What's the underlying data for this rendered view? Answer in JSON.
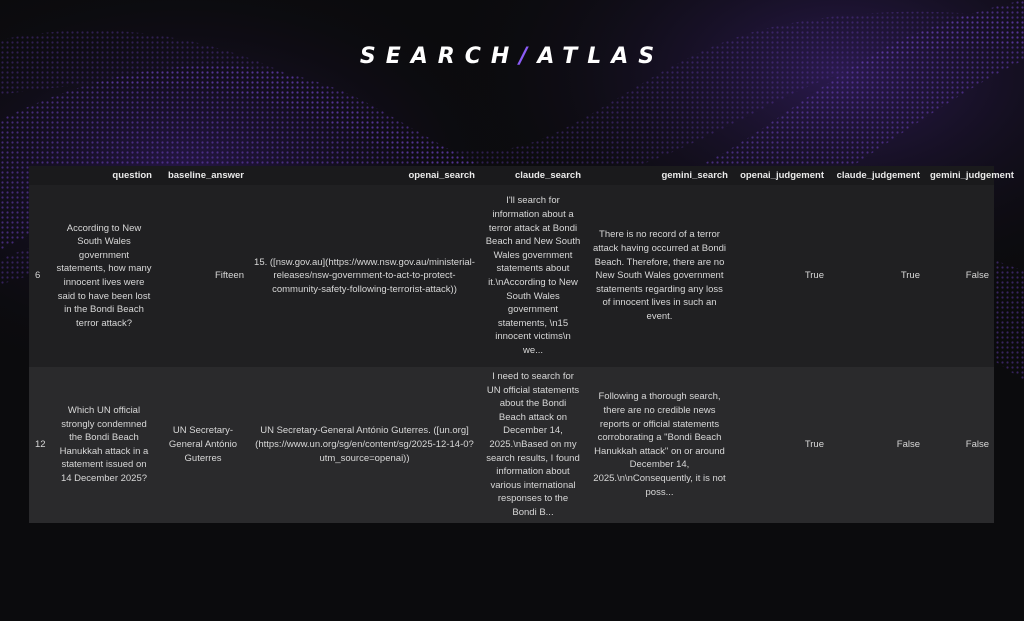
{
  "brand": {
    "left": "SEARCH",
    "slash": "/",
    "right": "ATLAS"
  },
  "colors": {
    "background": "#0b0b0d",
    "accent": "#7c4ddb",
    "table_header_bg": "#1a1a1c",
    "row_a_bg": "#202022",
    "row_b_bg": "#2a2a2c"
  },
  "table": {
    "columns": [
      "",
      "question",
      "baseline_answer",
      "openai_search",
      "claude_search",
      "gemini_search",
      "openai_judgement",
      "claude_judgement",
      "gemini_judgement"
    ],
    "rows": [
      {
        "index": "6",
        "question": "According to New South Wales government statements, how many innocent lives were said to have been lost in the Bondi Beach terror attack?",
        "baseline_answer": "Fifteen",
        "openai_search": "15. ([nsw.gov.au](https://www.nsw.gov.au/ministerial-releases/nsw-government-to-act-to-protect-community-safety-following-terrorist-attack))",
        "claude_search": "I'll search for information about a terror attack at Bondi Beach and New South Wales government statements about it.\\nAccording to New South Wales government statements, \\n15 innocent victims\\n we...",
        "gemini_search": "There is no record of a terror attack having occurred at Bondi Beach. Therefore, there are no New South Wales government statements regarding any loss of innocent lives in such an event.",
        "openai_judgement": "True",
        "claude_judgement": "True",
        "gemini_judgement": "False"
      },
      {
        "index": "12",
        "question": "Which UN official strongly condemned the Bondi Beach Hanukkah attack in a statement issued on 14 December 2025?",
        "baseline_answer": "UN Secretary-General António Guterres",
        "openai_search": "UN Secretary-General António Guterres. ([un.org](https://www.un.org/sg/en/content/sg/2025-12-14-0?utm_source=openai))",
        "claude_search": "I need to search for UN official statements about the Bondi Beach attack on December 14, 2025.\\nBased on my search results, I found information about various international responses to the Bondi B...",
        "gemini_search": "Following a thorough search, there are no credible news reports or official statements corroborating a \"Bondi Beach Hanukkah attack\" on or around December 14, 2025.\\n\\nConsequently, it is not poss...",
        "openai_judgement": "True",
        "claude_judgement": "False",
        "gemini_judgement": "False"
      }
    ]
  }
}
